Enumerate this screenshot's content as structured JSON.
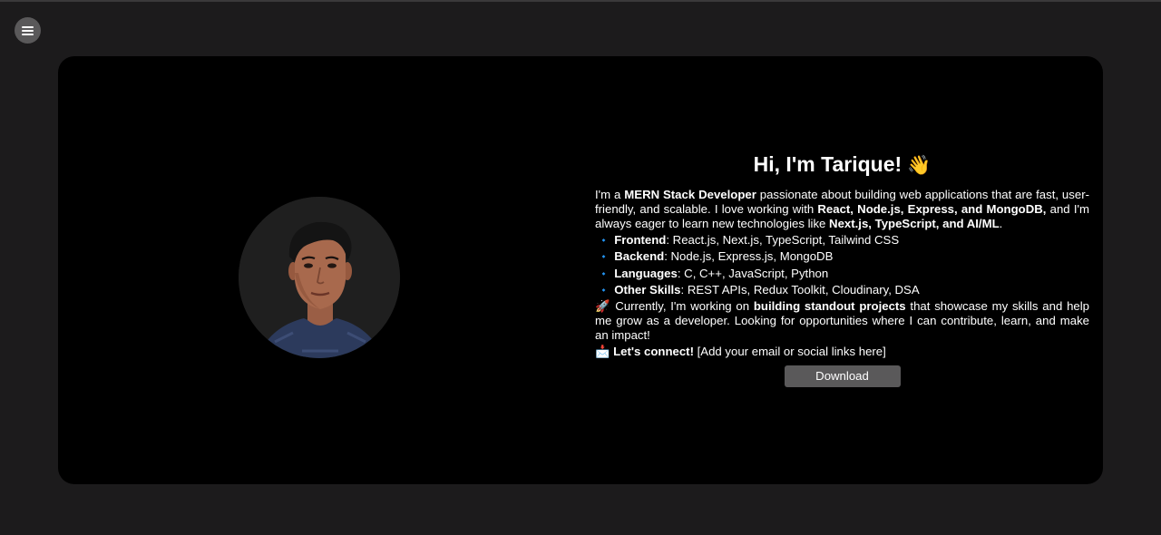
{
  "menu": {
    "icon": "hamburger-menu-icon"
  },
  "profile": {
    "avatar": {
      "icon": "profile-photo"
    }
  },
  "intro": {
    "title": "Hi, I'm Tarique!",
    "title_emoji": "👋",
    "para1": {
      "t1": "I'm a ",
      "b1": "MERN Stack Developer",
      "t2": " passionate about building web applications that are fast, user-friendly, and scalable. I love working with ",
      "b2": "React, Node.js, Express, and MongoDB,",
      "t3": " and I'm always eager to learn new technologies like ",
      "b3": "Next.js, TypeScript, and AI/ML",
      "t4": "."
    },
    "skills": [
      {
        "label": "Frontend",
        "value": ": React.js, Next.js, TypeScript, Tailwind CSS"
      },
      {
        "label": "Backend",
        "value": ": Node.js, Express.js, MongoDB"
      },
      {
        "label": "Languages",
        "value": ": C, C++, JavaScript, Python"
      },
      {
        "label": "Other Skills",
        "value": ": REST APIs, Redux Toolkit, Cloudinary, DSA"
      }
    ],
    "skill_bullet": "🔹",
    "para2": {
      "emoji": "🚀",
      "t1": " Currently, I'm working on ",
      "b1": "building standout projects",
      "t2": " that showcase my skills and help me grow as a developer. Looking for opportunities where I can contribute, learn, and make an impact!"
    },
    "connect": {
      "emoji": "📩",
      "label": "Let's connect!",
      "text": " [Add your email or social links here]"
    }
  },
  "download": {
    "label": "Download"
  }
}
